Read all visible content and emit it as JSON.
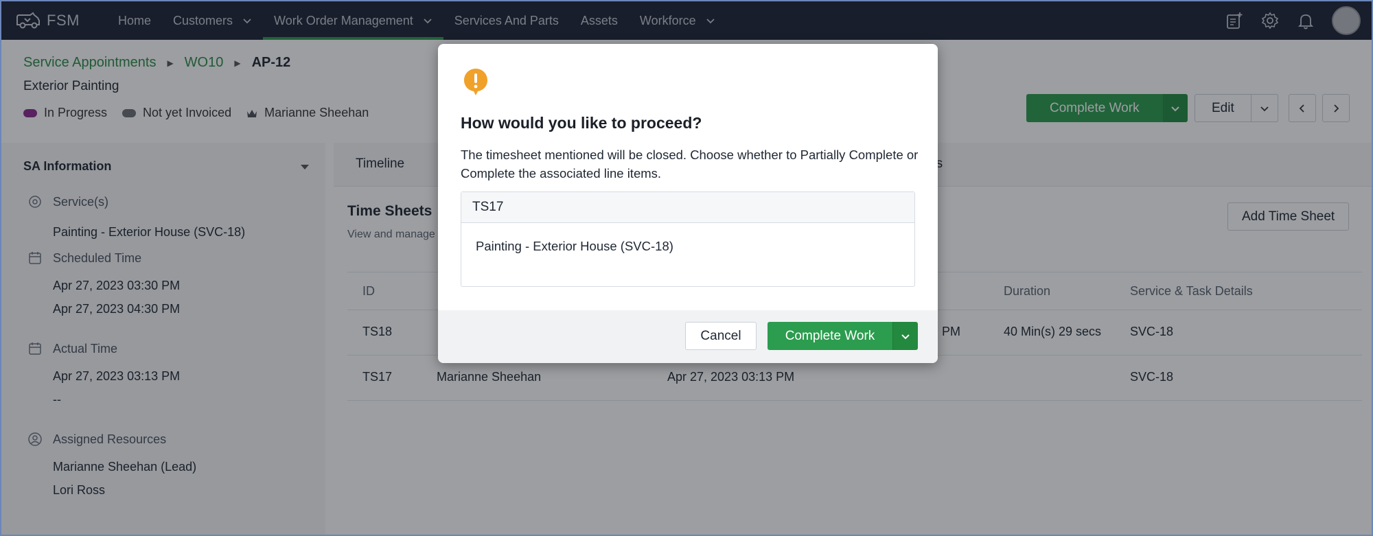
{
  "app": {
    "brand": "FSM",
    "nav": [
      {
        "label": "Home",
        "has_menu": false
      },
      {
        "label": "Customers",
        "has_menu": true
      },
      {
        "label": "Work Order Management",
        "has_menu": true,
        "active": true
      },
      {
        "label": "Services And Parts",
        "has_menu": false
      },
      {
        "label": "Assets",
        "has_menu": false
      },
      {
        "label": "Workforce",
        "has_menu": true
      }
    ],
    "accent": "#2c9c4f",
    "nav_bg": "#1c2434"
  },
  "breadcrumb": {
    "items": [
      "Service Appointments",
      "WO10"
    ],
    "current": "AP-12"
  },
  "record": {
    "title": "Exterior Painting",
    "status": "In Progress",
    "status_color": "#8a2a8f",
    "invoice_status": "Not yet Invoiced",
    "invoice_color": "#6b6f76",
    "owner": "Marianne Sheehan"
  },
  "actions": {
    "complete_work": "Complete Work",
    "edit": "Edit"
  },
  "sidebar": {
    "heading": "SA Information",
    "services_label": "Service(s)",
    "services_value": "Painting - Exterior House (SVC-18)",
    "scheduled_label": "Scheduled Time",
    "scheduled_start": "Apr 27, 2023 03:30 PM",
    "scheduled_end": "Apr 27, 2023 04:30 PM",
    "actual_label": "Actual Time",
    "actual_start": "Apr 27, 2023 03:13 PM",
    "actual_end": "--",
    "resources_label": "Assigned Resources",
    "resource_1": "Marianne Sheehan (Lead)",
    "resource_2": "Lori Ross"
  },
  "main": {
    "tab_timeline": "Timeline",
    "tab_partial": "es",
    "timesheets_title": "Time Sheets",
    "timesheets_sub": "View and manage",
    "add_button": "Add Time Sheet",
    "columns": {
      "id": "ID",
      "duration": "Duration",
      "details": "Service & Task Details"
    },
    "rows": [
      {
        "id": "TS18",
        "resource": "",
        "time_tail": "PM",
        "duration": "40 Min(s) 29 secs",
        "details": "SVC-18"
      },
      {
        "id": "TS17",
        "resource": "Marianne Sheehan",
        "time": "Apr 27, 2023 03:13 PM",
        "duration": "",
        "details": "SVC-18"
      }
    ]
  },
  "modal": {
    "icon": "warning-icon",
    "icon_color": "#f0a12a",
    "title": "How would you like to proceed?",
    "description": "The timesheet mentioned will be closed. Choose whether to Partially Complete or Complete the associated line items.",
    "timesheet_id": "TS17",
    "line_item": "Painting - Exterior House (SVC-18)",
    "cancel": "Cancel",
    "confirm": "Complete Work"
  }
}
